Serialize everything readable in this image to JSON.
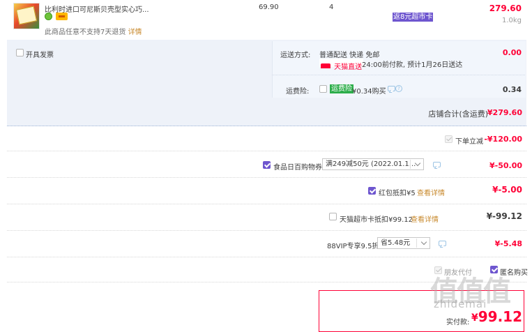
{
  "item": {
    "title": "比利时进口可尼斯贝壳型实心巧...",
    "unit_price": "69.90",
    "quantity": "4",
    "rebate_tag": "返8元超市卡",
    "subtotal": "279.60",
    "weight": "1.0kg",
    "return_notice": "此商品任意不支持7天退货",
    "detail_link": "详情"
  },
  "invoice": {
    "label": "开具发票"
  },
  "shipping": {
    "label": "运送方式:",
    "method": "普通配送 快递 免邮",
    "store_badge": "天猫直送",
    "delivery_note": "24:00前付款, 预计1月26日送达",
    "fee": "0.00"
  },
  "insurance": {
    "label": "运费险:",
    "badge": "运费险",
    "price_text": "¥0.34购买",
    "fee": "0.34"
  },
  "store_total": {
    "label": "店铺合计(含运费)",
    "value": "¥279.60"
  },
  "discounts": {
    "instant": {
      "label": "下单立减",
      "value": "-¥120.00"
    },
    "coupon": {
      "label": "食品日百购物券",
      "selected": "满249减50元 (2022.01.1...",
      "value": "¥-50.00"
    },
    "red_packet": {
      "label": "红包抵扣¥5",
      "link": "查看详情",
      "value": "¥-5.00"
    },
    "tmall_card": {
      "label": "天猫超市卡抵扣¥99.12",
      "link": "查看详情",
      "value": "¥-99.12"
    },
    "vip": {
      "label": "88VIP专享9.5折",
      "selected": "省5.48元",
      "value": "¥-5.48"
    }
  },
  "options": {
    "friend_pay": "朋友代付",
    "anonymous": "匿名购买"
  },
  "payment": {
    "label": "实付款:",
    "symbol": "¥",
    "value": "99.12"
  },
  "watermark": {
    "logo": "值值值",
    "site": "zhidemai"
  },
  "colors": {
    "price_red": "#ff0036",
    "accent_purple": "#6e56cf",
    "panel_bg": "#eef2f9",
    "input_bg": "#f2f6fc"
  }
}
